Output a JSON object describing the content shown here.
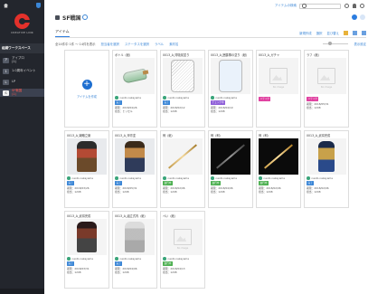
{
  "app": {
    "brand": "CREATIVE LINK",
    "colors": {
      "sidebar": "#23262d",
      "accent": "#2b7de0",
      "logo_red": "#e3312b",
      "active_label": "#ff5a50"
    }
  },
  "sidebar": {
    "section_title": "組織ワークスペース",
    "items": [
      {
        "num": "ア",
        "label": "アイプロ\n(1)"
      },
      {
        "num": "1",
        "label": "1.0周年イベント"
      },
      {
        "num": "L",
        "label": "LP"
      },
      {
        "num": "S",
        "label": "SF戦国\n(1)"
      }
    ]
  },
  "topbar": {
    "link": "アイテムの検索",
    "search_placeholder": "",
    "icons": [
      "search-icon",
      "settings-icon",
      "bell-icon",
      "help-icon"
    ]
  },
  "header": {
    "title": "SF戦国"
  },
  "tabs": {
    "active": "アイテム",
    "actions": [
      "新規作成",
      "選択",
      "並び替え"
    ]
  },
  "filters": {
    "count": "全14件中 1件 〜 14件を表示",
    "items": [
      "担当者を選択",
      "ステータスを選択",
      "ラベル",
      "素材名"
    ],
    "right_link": "表示設定"
  },
  "add_card": {
    "label": "アイテムを作成"
  },
  "cards": [
    {
      "title": "ボトル（紙）",
      "user": "naoto nakayama",
      "badge": "",
      "date": "期限：2018/04/26",
      "assignee": "担当：ヒッセル"
    },
    {
      "title": "0013_A_呼吸前塗り",
      "user": "naoto nakayama",
      "badge": "",
      "date": "期限：2018/02/12",
      "assignee": "担当：1208"
    },
    {
      "title": "0013_A_囲碁隊の塗り（紙）",
      "user": "naoto nakayama",
      "badge": "",
      "date": "期限：2018/04/19",
      "assignee": "担当：1208"
    },
    {
      "title": "0013_A_ガチャ",
      "user": "",
      "badge": "",
      "date": "",
      "assignee": ""
    },
    {
      "title": "ラフ（紙）",
      "user": "",
      "badge": "",
      "date": "期限：2018/05/31",
      "assignee": "担当：1208"
    },
    {
      "title": "0013_A_戦略立案",
      "user": "naoto nakayama",
      "badge": "",
      "date": "期限：2018/03/26",
      "assignee": "担当：1208"
    },
    {
      "title": "0013_A_甲冑塗",
      "user": "naoto nakayama",
      "badge": "",
      "date": "期限：2018/05/31",
      "assignee": "担当：1208"
    },
    {
      "title": "剣（紙）",
      "user": "naoto nakayama",
      "badge": "",
      "date": "期限：2018/02/06",
      "assignee": "担当：1208"
    },
    {
      "title": "剣（剣）",
      "user": "naoto nakayama",
      "badge": "",
      "date": "期限：2018/04/06",
      "assignee": "担当：1208"
    },
    {
      "title": "剣（剣）",
      "user": "naoto nakayama",
      "badge": "",
      "date": "期限：2018/02/06",
      "assignee": "担当：1208"
    },
    {
      "title": "0013_A_武将完成",
      "user": "naoto nakayama",
      "badge": "",
      "date": "期限：2018/02/06",
      "assignee": "担当：1208"
    },
    {
      "title": "0013_A_武将完成",
      "user": "naoto nakayama",
      "badge": "",
      "date": "期限：2018/03/31",
      "assignee": "担当：1208"
    },
    {
      "title": "0013_A_組立式内（紙）",
      "user": "naoto nakayama",
      "badge": "",
      "date": "期限：2018/04/06",
      "assignee": "担当：1208"
    },
    {
      "title": "ぺい（紙）",
      "user": "naoto nakayama",
      "badge": "",
      "date": "期限：2018/04/13",
      "assignee": "担当：1208"
    }
  ],
  "badges": {
    "ok": "完了",
    "wip": "進行中",
    "retake": "リテイク",
    "check": "チェック中"
  }
}
